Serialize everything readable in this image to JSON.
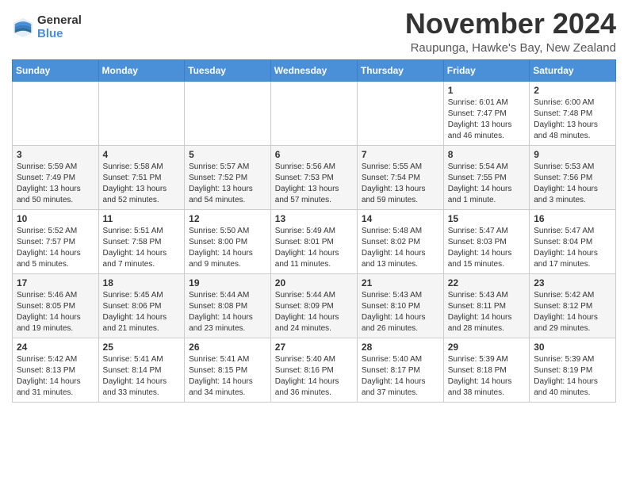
{
  "header": {
    "logo_general": "General",
    "logo_blue": "Blue",
    "month_title": "November 2024",
    "location": "Raupunga, Hawke's Bay, New Zealand"
  },
  "weekdays": [
    "Sunday",
    "Monday",
    "Tuesday",
    "Wednesday",
    "Thursday",
    "Friday",
    "Saturday"
  ],
  "rows": [
    [
      {
        "day": "",
        "info": ""
      },
      {
        "day": "",
        "info": ""
      },
      {
        "day": "",
        "info": ""
      },
      {
        "day": "",
        "info": ""
      },
      {
        "day": "",
        "info": ""
      },
      {
        "day": "1",
        "info": "Sunrise: 6:01 AM\nSunset: 7:47 PM\nDaylight: 13 hours\nand 46 minutes."
      },
      {
        "day": "2",
        "info": "Sunrise: 6:00 AM\nSunset: 7:48 PM\nDaylight: 13 hours\nand 48 minutes."
      }
    ],
    [
      {
        "day": "3",
        "info": "Sunrise: 5:59 AM\nSunset: 7:49 PM\nDaylight: 13 hours\nand 50 minutes."
      },
      {
        "day": "4",
        "info": "Sunrise: 5:58 AM\nSunset: 7:51 PM\nDaylight: 13 hours\nand 52 minutes."
      },
      {
        "day": "5",
        "info": "Sunrise: 5:57 AM\nSunset: 7:52 PM\nDaylight: 13 hours\nand 54 minutes."
      },
      {
        "day": "6",
        "info": "Sunrise: 5:56 AM\nSunset: 7:53 PM\nDaylight: 13 hours\nand 57 minutes."
      },
      {
        "day": "7",
        "info": "Sunrise: 5:55 AM\nSunset: 7:54 PM\nDaylight: 13 hours\nand 59 minutes."
      },
      {
        "day": "8",
        "info": "Sunrise: 5:54 AM\nSunset: 7:55 PM\nDaylight: 14 hours\nand 1 minute."
      },
      {
        "day": "9",
        "info": "Sunrise: 5:53 AM\nSunset: 7:56 PM\nDaylight: 14 hours\nand 3 minutes."
      }
    ],
    [
      {
        "day": "10",
        "info": "Sunrise: 5:52 AM\nSunset: 7:57 PM\nDaylight: 14 hours\nand 5 minutes."
      },
      {
        "day": "11",
        "info": "Sunrise: 5:51 AM\nSunset: 7:58 PM\nDaylight: 14 hours\nand 7 minutes."
      },
      {
        "day": "12",
        "info": "Sunrise: 5:50 AM\nSunset: 8:00 PM\nDaylight: 14 hours\nand 9 minutes."
      },
      {
        "day": "13",
        "info": "Sunrise: 5:49 AM\nSunset: 8:01 PM\nDaylight: 14 hours\nand 11 minutes."
      },
      {
        "day": "14",
        "info": "Sunrise: 5:48 AM\nSunset: 8:02 PM\nDaylight: 14 hours\nand 13 minutes."
      },
      {
        "day": "15",
        "info": "Sunrise: 5:47 AM\nSunset: 8:03 PM\nDaylight: 14 hours\nand 15 minutes."
      },
      {
        "day": "16",
        "info": "Sunrise: 5:47 AM\nSunset: 8:04 PM\nDaylight: 14 hours\nand 17 minutes."
      }
    ],
    [
      {
        "day": "17",
        "info": "Sunrise: 5:46 AM\nSunset: 8:05 PM\nDaylight: 14 hours\nand 19 minutes."
      },
      {
        "day": "18",
        "info": "Sunrise: 5:45 AM\nSunset: 8:06 PM\nDaylight: 14 hours\nand 21 minutes."
      },
      {
        "day": "19",
        "info": "Sunrise: 5:44 AM\nSunset: 8:08 PM\nDaylight: 14 hours\nand 23 minutes."
      },
      {
        "day": "20",
        "info": "Sunrise: 5:44 AM\nSunset: 8:09 PM\nDaylight: 14 hours\nand 24 minutes."
      },
      {
        "day": "21",
        "info": "Sunrise: 5:43 AM\nSunset: 8:10 PM\nDaylight: 14 hours\nand 26 minutes."
      },
      {
        "day": "22",
        "info": "Sunrise: 5:43 AM\nSunset: 8:11 PM\nDaylight: 14 hours\nand 28 minutes."
      },
      {
        "day": "23",
        "info": "Sunrise: 5:42 AM\nSunset: 8:12 PM\nDaylight: 14 hours\nand 29 minutes."
      }
    ],
    [
      {
        "day": "24",
        "info": "Sunrise: 5:42 AM\nSunset: 8:13 PM\nDaylight: 14 hours\nand 31 minutes."
      },
      {
        "day": "25",
        "info": "Sunrise: 5:41 AM\nSunset: 8:14 PM\nDaylight: 14 hours\nand 33 minutes."
      },
      {
        "day": "26",
        "info": "Sunrise: 5:41 AM\nSunset: 8:15 PM\nDaylight: 14 hours\nand 34 minutes."
      },
      {
        "day": "27",
        "info": "Sunrise: 5:40 AM\nSunset: 8:16 PM\nDaylight: 14 hours\nand 36 minutes."
      },
      {
        "day": "28",
        "info": "Sunrise: 5:40 AM\nSunset: 8:17 PM\nDaylight: 14 hours\nand 37 minutes."
      },
      {
        "day": "29",
        "info": "Sunrise: 5:39 AM\nSunset: 8:18 PM\nDaylight: 14 hours\nand 38 minutes."
      },
      {
        "day": "30",
        "info": "Sunrise: 5:39 AM\nSunset: 8:19 PM\nDaylight: 14 hours\nand 40 minutes."
      }
    ]
  ]
}
